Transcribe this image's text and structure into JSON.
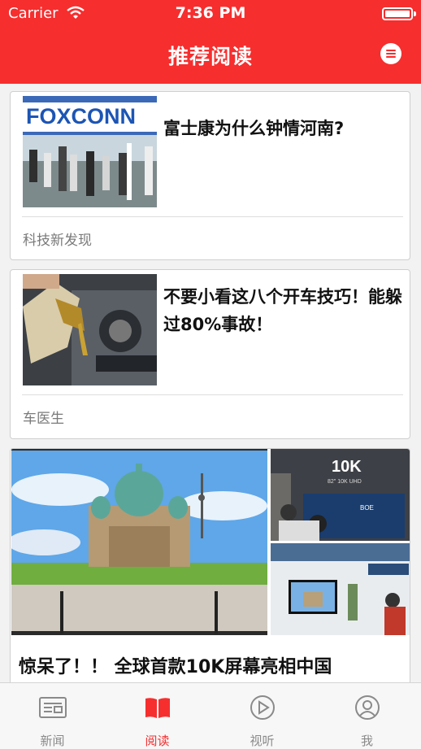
{
  "status_bar": {
    "carrier": "Carrier",
    "time": "7:36 PM"
  },
  "header": {
    "title": "推荐阅读",
    "menu_icon": "menu-icon"
  },
  "articles": [
    {
      "title": "富士康为什么钟情河南?",
      "source": "科技新发现",
      "image_text": "FOXCONN"
    },
    {
      "title": "不要小看这八个开车技巧！能躲过80%事故！",
      "source": "车医生"
    }
  ],
  "featured": {
    "title": "惊呆了！！ 全球首款10K屏幕亮相中国",
    "image_text": "10K",
    "image_subtext": "82\" 10K UHD",
    "brand": "BOE"
  },
  "tabs": [
    {
      "label": "新闻",
      "icon": "news-icon",
      "active": false
    },
    {
      "label": "阅读",
      "icon": "book-icon",
      "active": true
    },
    {
      "label": "视听",
      "icon": "play-icon",
      "active": false
    },
    {
      "label": "我",
      "icon": "user-icon",
      "active": false
    }
  ],
  "colors": {
    "accent": "#f62e2e",
    "background": "#f2f2f2"
  }
}
